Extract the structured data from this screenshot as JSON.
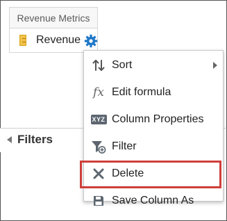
{
  "header": {
    "column_title": "Revenue Metrics"
  },
  "column": {
    "label": "Revenue"
  },
  "filters": {
    "title": "Filters"
  },
  "menu": {
    "items": [
      {
        "label": "Sort",
        "icon": "sort-icon",
        "has_submenu": true
      },
      {
        "label": "Edit formula",
        "icon": "fx-icon"
      },
      {
        "label": "Column Properties",
        "icon": "column-properties-icon",
        "icon_text": "XYZ"
      },
      {
        "label": "Filter",
        "icon": "filter-add-icon"
      },
      {
        "label": "Delete",
        "icon": "delete-x-icon",
        "highlighted": true
      },
      {
        "label": "Save Column As",
        "icon": "save-icon"
      }
    ]
  },
  "colors": {
    "highlight": "#cf3f3a",
    "gear": "#1f77c8",
    "column_icon": "#f2c24a"
  }
}
